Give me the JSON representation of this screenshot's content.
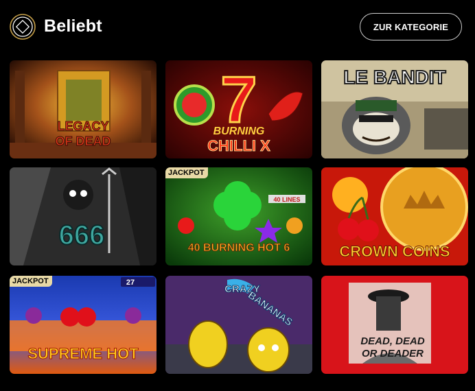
{
  "header": {
    "title": "Beliebt",
    "category_button": "ZUR KATEGORIE"
  },
  "games": [
    {
      "title_line1": "LEGACY",
      "title_line2": "OF DEAD",
      "badge": ""
    },
    {
      "title_line1": "BURNING",
      "title_line2": "CHILLI X",
      "badge": ""
    },
    {
      "title_line1": "LE BANDIT",
      "badge": ""
    },
    {
      "title_line1": "666",
      "badge": ""
    },
    {
      "title_line1": "40 BURNING HOT 6",
      "lines_label": "40 LINES",
      "badge": "JACKPOT"
    },
    {
      "title_line1": "CROWN COINS",
      "badge": ""
    },
    {
      "title_line1": "SUPREME HOT",
      "badge": "JACKPOT",
      "lines_label": "27"
    },
    {
      "title_line1": "CRAZY",
      "title_line2": "BANANAS",
      "badge": ""
    },
    {
      "title_line1": "DEAD, DEAD",
      "title_line2": "OR DEADER",
      "badge": ""
    }
  ],
  "colors": {
    "background": "#000000",
    "badge_bg": "#e8d9a6",
    "button_border": "#cfcfcf"
  }
}
